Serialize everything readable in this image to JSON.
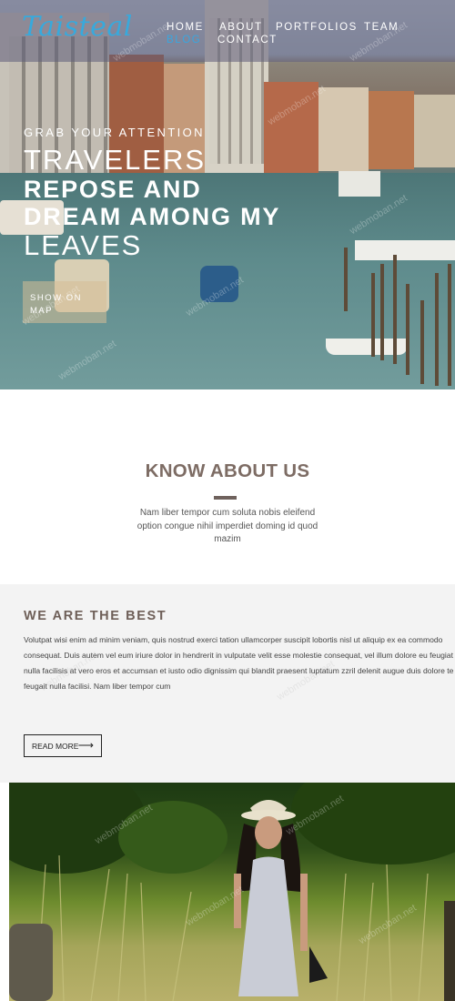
{
  "brand": {
    "logo": "Taisteal",
    "accent": "#38a9dc"
  },
  "nav": {
    "items": [
      {
        "label": "HOME"
      },
      {
        "label": "ABOUT"
      },
      {
        "label": "PORTFOLIOS"
      },
      {
        "label": "TEAM"
      },
      {
        "label": "BLOG",
        "active": true
      },
      {
        "label": "CONTACT"
      }
    ]
  },
  "hero": {
    "kicker": "GRAB YOUR ATTENTION",
    "line1": "TRAVELERS",
    "line2": "REPOSE AND",
    "line3": "DREAM AMONG MY",
    "line4": "LEAVES",
    "cta": "SHOW ON MAP"
  },
  "about": {
    "title": "KNOW ABOUT US",
    "text": "Nam liber tempor cum soluta nobis eleifend option congue nihil imperdiet doming id quod mazim"
  },
  "best": {
    "title": "WE ARE THE BEST",
    "text": "Volutpat wisi enim ad minim veniam, quis nostrud exerci tation ullamcorper suscipit lobortis nisl ut aliquip ex ea commodo consequat. Duis autem vel eum iriure dolor in hendrerit in vulputate velit esse molestie consequat, vel illum dolore eu feugiat nulla facilisis at vero eros et accumsan et iusto odio dignissim qui blandit praesent luptatum zzril delenit augue duis dolore te feugait nulla facilisi. Nam liber tempor cum",
    "button": "READ MORE",
    "button_icon": "arrow-right-icon"
  },
  "watermark": "webmoban.net"
}
